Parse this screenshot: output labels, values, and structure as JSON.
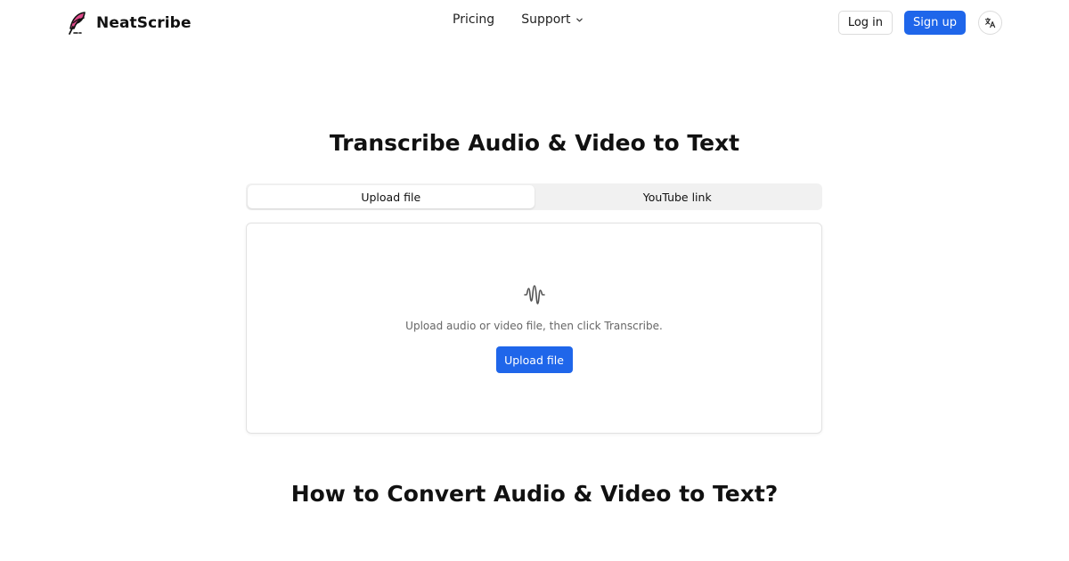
{
  "brand": {
    "name": "NeatScribe",
    "logo_icon": "feather-quill-icon",
    "accent_color": "#e0498a"
  },
  "nav": {
    "items": [
      {
        "label": "Pricing"
      },
      {
        "label": "Support",
        "icon": "chevron-down-icon"
      }
    ]
  },
  "header_actions": {
    "login_label": "Log in",
    "signup_label": "Sign up",
    "language_icon": "translate-icon",
    "primary_color": "#1f66ea"
  },
  "main": {
    "title": "Transcribe Audio & Video to Text",
    "tabs": [
      {
        "label": "Upload file",
        "active": true
      },
      {
        "label": "YouTube link",
        "active": false
      }
    ],
    "dropzone": {
      "icon": "audio-wave-icon",
      "hint": "Upload audio or video file, then click Transcribe.",
      "button_label": "Upload file"
    }
  },
  "section": {
    "heading": "How to Convert Audio & Video to Text?"
  }
}
